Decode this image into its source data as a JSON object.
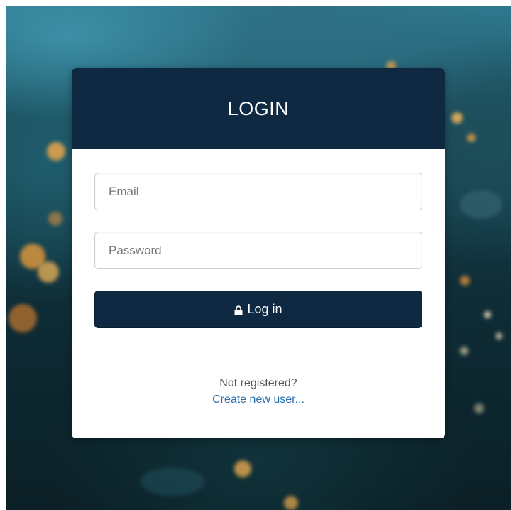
{
  "login": {
    "title": "LOGIN",
    "email_placeholder": "Email",
    "password_placeholder": "Password",
    "submit_label": "Log in",
    "divider": true,
    "not_registered_text": "Not registered?",
    "create_user_link": "Create new user..."
  },
  "theme": {
    "header_color": "#0f2942",
    "button_color": "#0f2942",
    "link_color": "#2a6fb0",
    "icons": [
      "lock-icon"
    ]
  }
}
